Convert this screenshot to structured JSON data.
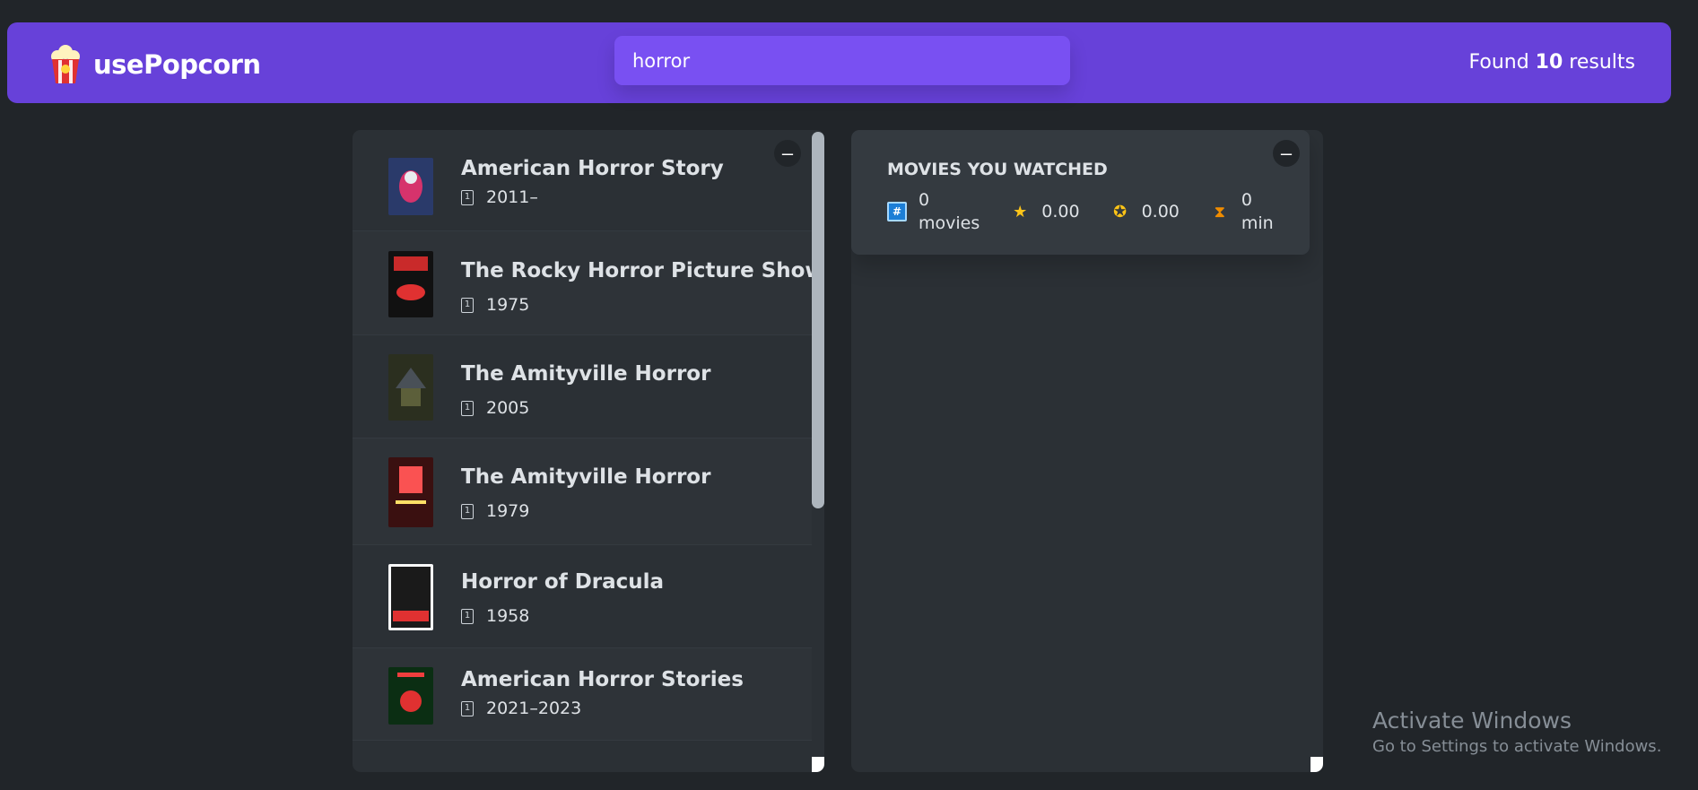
{
  "app": {
    "name": "usePopcorn"
  },
  "search": {
    "value": "horror"
  },
  "results": {
    "prefix": "Found",
    "count": "10",
    "suffix": "results"
  },
  "movies": [
    {
      "title": "American Horror Story",
      "year": "2011–"
    },
    {
      "title": "The Rocky Horror Picture Show",
      "year": "1975"
    },
    {
      "title": "The Amityville Horror",
      "year": "2005"
    },
    {
      "title": "The Amityville Horror",
      "year": "1979"
    },
    {
      "title": "Horror of Dracula",
      "year": "1958"
    },
    {
      "title": "American Horror Stories",
      "year": "2021–2023"
    }
  ],
  "toggle_label": "–",
  "watched_summary": {
    "title": "MOVIES YOU WATCHED",
    "movies_count": "0",
    "movies_label": "movies",
    "imdb_rating": "0.00",
    "user_rating": "0.00",
    "runtime_value": "0",
    "runtime_unit": "min"
  },
  "watermark": {
    "title": "Activate Windows",
    "subtitle": "Go to Settings to activate Windows."
  },
  "colors": {
    "background": "#212529",
    "primary": "#6741d9",
    "primary_light": "#7950f2",
    "box": "#2b3035",
    "summary": "#343a40"
  }
}
